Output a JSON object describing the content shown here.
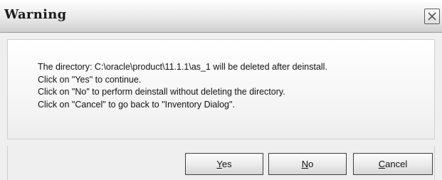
{
  "dialog": {
    "title": "Warning",
    "close_icon": "close-icon"
  },
  "message": {
    "lines": [
      "The directory: C:\\oracle\\product\\11.1.1\\as_1 will be deleted after deinstall.",
      "Click on \"Yes\" to continue.",
      "Click on \"No\" to perform deinstall without deleting the directory.",
      "Click on \"Cancel\" to go back to \"Inventory Dialog\"."
    ]
  },
  "buttons": {
    "yes": {
      "mnemonic": "Y",
      "rest": "es"
    },
    "no": {
      "mnemonic": "N",
      "rest": "o"
    },
    "cancel": {
      "mnemonic": "C",
      "rest": "ancel"
    }
  }
}
